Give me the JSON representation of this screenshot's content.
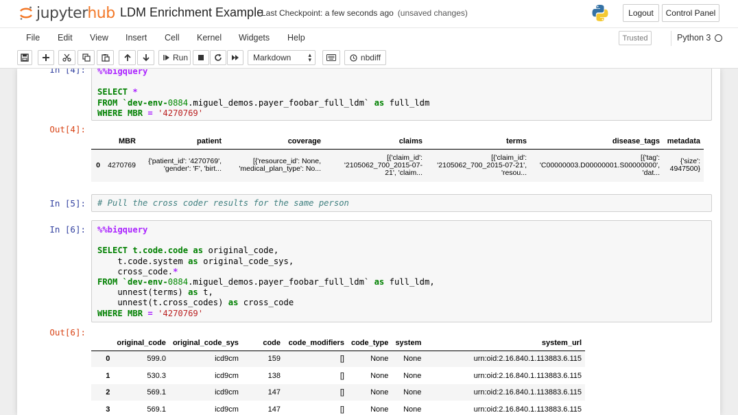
{
  "header": {
    "logo_prefix": "jupyter",
    "logo_suffix": "hub",
    "notebook_title": "LDM Enrichment Example",
    "checkpoint": "Last Checkpoint: a few seconds ago",
    "unsaved": "(unsaved changes)",
    "logout": "Logout",
    "control_panel": "Control Panel"
  },
  "menu": {
    "items": [
      "File",
      "Edit",
      "View",
      "Insert",
      "Cell",
      "Kernel",
      "Widgets",
      "Help"
    ],
    "trusted": "Trusted",
    "kernel": "Python 3"
  },
  "toolbar": {
    "run": "Run",
    "cell_type": "Markdown",
    "nbdiff": "nbdiff"
  },
  "cells": {
    "in4": {
      "prompt": "In [4]:",
      "magic": "%%bigquery",
      "l1a": "SELECT ",
      "l1b": "*",
      "l2a": "FROM `dev-env-",
      "l2b": "0884",
      "l2c": ".miguel_demos.payer_foobar_full_ldm` ",
      "l2d": "as",
      "l2e": " full_ldm",
      "l3a": "WHERE MBR ",
      "l3b": "=",
      "l3c": "'4270769'"
    },
    "out4": {
      "prompt": "Out[4]:",
      "columns": [
        "",
        "MBR",
        "patient",
        "coverage",
        "claims",
        "terms",
        "disease_tags",
        "metadata"
      ],
      "row": {
        "index": "0",
        "mbr": "4270769",
        "patient_1": "{'patient_id': '4270769',",
        "patient_2": "'gender': 'F', 'birt...",
        "coverage_1": "[{'resource_id': None,",
        "coverage_2": "'medical_plan_type': No...",
        "claims_1": "[{'claim_id':",
        "claims_2": "'2105062_700_2015-07-",
        "claims_3": "21', 'claim...",
        "terms_1": "[{'claim_id':",
        "terms_2": "'2105062_700_2015-07-21',",
        "terms_3": "'resou...",
        "tags_1": "[{'tag':",
        "tags_2": "'C00000003.D00000001.S00000000',",
        "tags_3": "'dat...",
        "meta_1": "{'size':",
        "meta_2": "4947500}"
      }
    },
    "in5": {
      "prompt": "In [5]:",
      "comment": "# Pull the cross coder results for the same person"
    },
    "in6": {
      "prompt": "In [6]:",
      "magic": "%%bigquery",
      "l1a": "SELECT t.code.code ",
      "l1b": "as",
      "l1c": " original_code,",
      "l2a": "    t.code.system ",
      "l2b": "as",
      "l2c": " original_code_sys,",
      "l3a": "    cross_code.",
      "l3b": "*",
      "l4a": "FROM `dev-env-",
      "l4b": "0884",
      "l4c": ".miguel_demos.payer_foobar_full_ldm` ",
      "l4d": "as",
      "l4e": " full_ldm,",
      "l5a": "    unnest(terms) ",
      "l5b": "as",
      "l5c": " t,",
      "l6a": "    unnest(t.cross_codes) ",
      "l6b": "as",
      "l6c": " cross_code",
      "l7a": "WHERE MBR ",
      "l7b": "=",
      "l7c": "'4270769'"
    },
    "out6": {
      "prompt": "Out[6]:",
      "columns": [
        "",
        "original_code",
        "original_code_sys",
        "code",
        "code_modifiers",
        "code_type",
        "system",
        "system_url"
      ],
      "rows": [
        [
          "0",
          "599.0",
          "icd9cm",
          "159",
          "[]",
          "None",
          "None",
          "urn:oid:2.16.840.1.113883.6.115"
        ],
        [
          "1",
          "530.3",
          "icd9cm",
          "138",
          "[]",
          "None",
          "None",
          "urn:oid:2.16.840.1.113883.6.115"
        ],
        [
          "2",
          "569.1",
          "icd9cm",
          "147",
          "[]",
          "None",
          "None",
          "urn:oid:2.16.840.1.113883.6.115"
        ],
        [
          "3",
          "569.1",
          "icd9cm",
          "147",
          "[]",
          "None",
          "None",
          "urn:oid:2.16.840.1.113883.6.115"
        ]
      ]
    }
  }
}
